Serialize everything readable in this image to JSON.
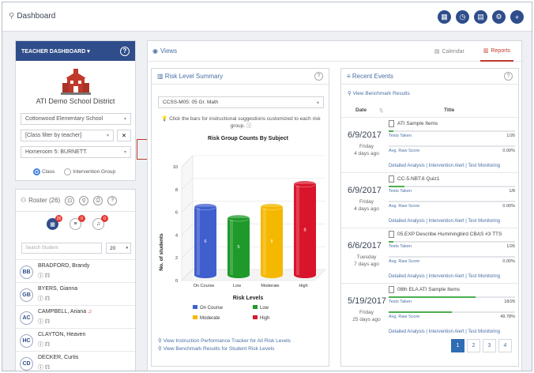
{
  "app": {
    "title": "Dashboard",
    "top_icons": [
      "apps-icon",
      "clock-icon",
      "calendar-icon",
      "gear-icon",
      "plus-icon"
    ]
  },
  "teacher": {
    "header": "TEACHER DASHBOARD ▾",
    "district": "ATI Demo School District",
    "school": "Cottonwood Elementary School",
    "class_filter": "[Class filter by teacher]",
    "homeroom": "Homeroom 5: BURNETT.",
    "radio_class": "Class",
    "radio_group": "Intervention Group"
  },
  "roster": {
    "title": "Roster (26)",
    "badge_counts": [
      "26",
      "0",
      "0"
    ],
    "search_placeholder": "Search Student",
    "page_size": "20",
    "students": [
      {
        "initials": "BB",
        "name": "BRADFORD, Brandy"
      },
      {
        "initials": "GB",
        "name": "BYERS, Gianna"
      },
      {
        "initials": "AC",
        "name": "CAMPBELL, Ariana"
      },
      {
        "initials": "HC",
        "name": "CLAYTON, Heaven"
      },
      {
        "initials": "CD",
        "name": "DECKER, Curtis"
      }
    ]
  },
  "views": {
    "title": "Views",
    "tabs": {
      "calendar": "Calendar",
      "reports": "Reports"
    }
  },
  "risk": {
    "title": "Risk Level Summary",
    "subject": "CCSS-M05: 05 Gr. Math",
    "hint": "Click the bars for instructional suggestions customized to each risk group.",
    "links": [
      "View Instruction Performance Tracker for All Risk Levels",
      "View Benchmark Results for Student Risk Levels"
    ]
  },
  "chart_data": {
    "type": "bar",
    "title": "Risk Group Counts By Subject",
    "xlabel": "Risk Levels",
    "ylabel": "No. of students",
    "categories": [
      "On Course",
      "Low",
      "Moderate",
      "High"
    ],
    "values": [
      6,
      5,
      6,
      8
    ],
    "colors": [
      "#3f5fcf",
      "#1f9a2a",
      "#f5b800",
      "#d9152b"
    ],
    "ylim": [
      0,
      10
    ],
    "yticks": [
      "0",
      "2",
      "4",
      "6",
      "8",
      "10"
    ],
    "legend": [
      "On Course",
      "Low",
      "Moderate",
      "High"
    ],
    "legend_position": "bottom",
    "grid": true
  },
  "events": {
    "title": "Recent Events",
    "benchmark_link": "View Benchmark Results",
    "col_date": "Date",
    "col_title": "Title",
    "row_labels": {
      "taken": "Tests Taken",
      "avg": "Avg. Raw Score"
    },
    "actions": "Detailed Analysis | Intervention Alert | Test Monitoring",
    "items": [
      {
        "date": "6/9/2017",
        "dow": "Friday",
        "ago": "4 days ago",
        "name": "ATI Sample Items",
        "taken": "1/26",
        "taken_pct": 0.04,
        "avg": "0.00%",
        "avg_pct": 0
      },
      {
        "date": "6/9/2017",
        "dow": "Friday",
        "ago": "4 days ago",
        "name": "CC-5.NBT.6 Quiz1",
        "taken": "1/8",
        "taken_pct": 0.125,
        "avg": "0.00%",
        "avg_pct": 0
      },
      {
        "date": "6/6/2017",
        "dow": "Tuesday",
        "ago": "7 days ago",
        "name": "05.EXP Describe Hummingbird CBAS #3 TTS",
        "taken": "1/26",
        "taken_pct": 0.04,
        "avg": "0.00%",
        "avg_pct": 0
      },
      {
        "date": "5/19/2017",
        "dow": "Friday",
        "ago": "25 days ago",
        "name": "08th ELA ATI Sample Items",
        "taken": "18/26",
        "taken_pct": 0.69,
        "avg": "49.78%",
        "avg_pct": 0.4978
      }
    ],
    "pages": [
      "1",
      "2",
      "3",
      "4"
    ]
  }
}
